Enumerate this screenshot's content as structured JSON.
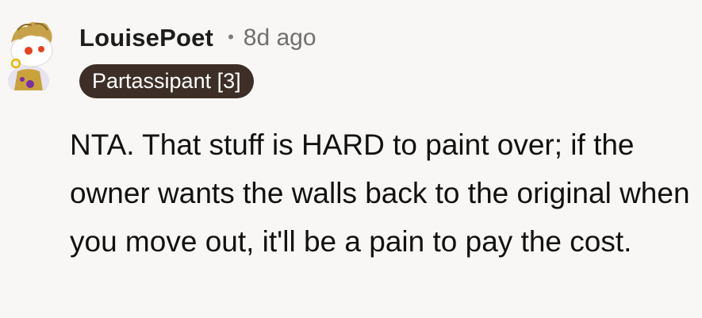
{
  "comment": {
    "username": "LouisePoet",
    "separator": "•",
    "time": "8d ago",
    "flair": "Partassipant [3]",
    "body": "NTA. That stuff is HARD to paint over; if the owner wants the walls back to the original when you move out, it'll be a pain to pay the cost."
  },
  "colors": {
    "background": "#f8f7f5",
    "flair_bg": "#3d2f27",
    "flair_text": "#ffffff",
    "username": "#1c1c1c",
    "meta": "#6f6f6f"
  },
  "icons": {
    "avatar": "snoo-avatar-icon"
  }
}
